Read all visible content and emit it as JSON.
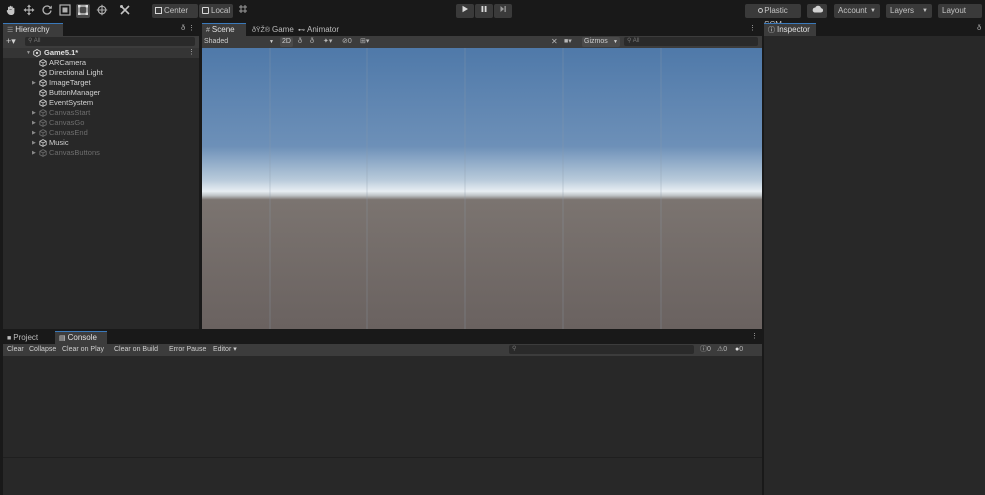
{
  "toolbar": {
    "center_label": "Center",
    "local_label": "Local",
    "plastic_label": "Plastic SCM",
    "account_label": "Account",
    "layers_label": "Layers",
    "layout_label": "Layout"
  },
  "hierarchy": {
    "tab_label": "Hierarchy",
    "search_placeholder": "All",
    "scene_name": "Game5.1*",
    "items": [
      {
        "label": "ARCamera",
        "has_children": false,
        "active": true
      },
      {
        "label": "Directional Light",
        "has_children": false,
        "active": true
      },
      {
        "label": "ImageTarget",
        "has_children": true,
        "active": true
      },
      {
        "label": "ButtonManager",
        "has_children": false,
        "active": true
      },
      {
        "label": "EventSystem",
        "has_children": false,
        "active": true
      },
      {
        "label": "CanvasStart",
        "has_children": true,
        "active": false
      },
      {
        "label": "CanvasGo",
        "has_children": true,
        "active": false
      },
      {
        "label": "CanvasEnd",
        "has_children": true,
        "active": false
      },
      {
        "label": "Music",
        "has_children": true,
        "active": true
      },
      {
        "label": "CanvasButtons",
        "has_children": true,
        "active": false
      }
    ]
  },
  "scene_view": {
    "tabs": [
      {
        "label": "Scene",
        "icon": "grid-icon"
      },
      {
        "label": "Game",
        "icon": "gamepad-icon"
      },
      {
        "label": "Animator",
        "icon": "animator-icon"
      }
    ],
    "active_tab": 0,
    "shading_mode": "Shaded",
    "mode_2d_label": "2D",
    "hidden_count": "0",
    "gizmos_label": "Gizmos",
    "search_placeholder": "All",
    "colors": {
      "sky_top": "#4f79a9",
      "sky_horizon": "#e8eef3",
      "ground_top": "#7b7470",
      "ground_bottom": "#6a6260"
    }
  },
  "inspector": {
    "tab_label": "Inspector"
  },
  "bottom": {
    "tabs": [
      {
        "label": "Project",
        "icon": "folder-icon"
      },
      {
        "label": "Console",
        "icon": "console-icon"
      }
    ],
    "active_tab": 1,
    "console_buttons": [
      "Clear",
      "Collapse",
      "Clear on Play",
      "Clear on Build",
      "Error Pause"
    ],
    "editor_dropdown": "Editor",
    "counts": {
      "log": "0",
      "warning": "0",
      "error": "0"
    }
  }
}
